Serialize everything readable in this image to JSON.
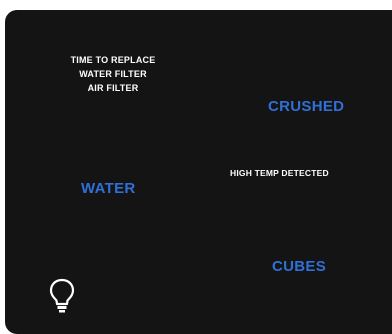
{
  "alert": {
    "line1": "TIME TO REPLACE",
    "line2": "WATER FILTER",
    "line3": "AIR FILTER"
  },
  "buttons": {
    "crushed": "CRUSHED",
    "water": "WATER",
    "cubes": "CUBES"
  },
  "status": {
    "temp": "HIGH TEMP DETECTED"
  },
  "icons": {
    "light": "lightbulb-icon"
  },
  "colors": {
    "panel_bg": "#141414",
    "accent_blue": "#2f6fd6",
    "text_white": "#ffffff"
  }
}
